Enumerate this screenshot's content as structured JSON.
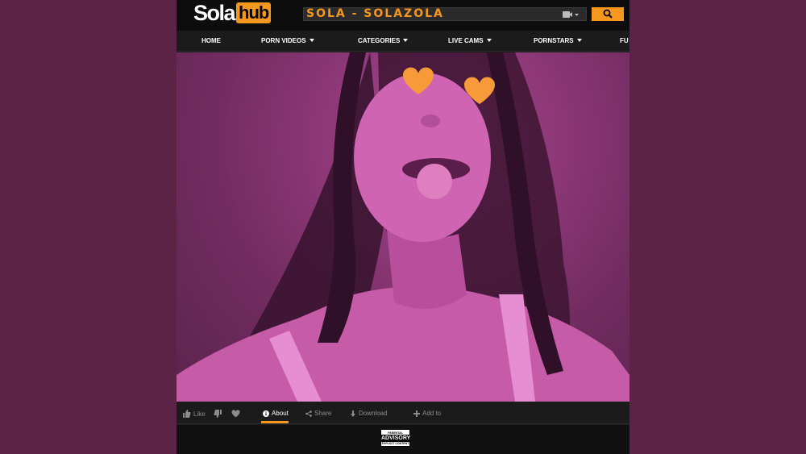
{
  "header": {
    "logo_part1": "Sola",
    "logo_part2": "hub",
    "search_text": "SOLA - SOLAZOLA"
  },
  "nav": {
    "items": [
      "HOME",
      "PORN VIDEOS",
      "CATEGORIES",
      "LIVE CAMS",
      "PORNSTARS",
      "FU"
    ]
  },
  "actions": {
    "like": "Like",
    "about": "About",
    "share": "Share",
    "download": "Download",
    "add_to": "Add to"
  },
  "advisory": {
    "top": "PARENTAL",
    "middle": "ADVISORY",
    "bottom": "EXPLICIT CONTENT"
  },
  "colors": {
    "background": "#5c2346",
    "accent": "#f7971d",
    "photo_tint": "#b04e95"
  }
}
